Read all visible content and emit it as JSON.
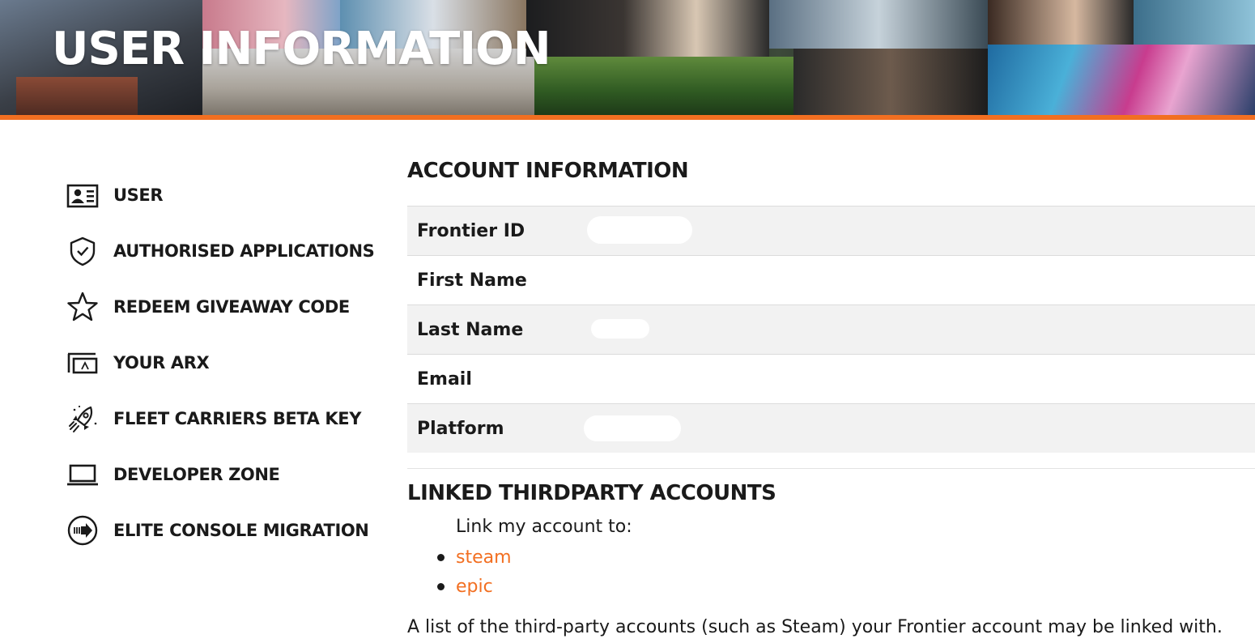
{
  "banner": {
    "title": "USER INFORMATION",
    "accent_color": "#f26f21"
  },
  "sidebar": {
    "items": [
      {
        "label": "USER",
        "icon": "user-card-icon"
      },
      {
        "label": "AUTHORISED APPLICATIONS",
        "icon": "shield-check-icon"
      },
      {
        "label": "REDEEM GIVEAWAY CODE",
        "icon": "star-icon"
      },
      {
        "label": "YOUR ARX",
        "icon": "arx-icon"
      },
      {
        "label": "FLEET CARRIERS BETA KEY",
        "icon": "rocket-icon"
      },
      {
        "label": "DEVELOPER ZONE",
        "icon": "laptop-icon"
      },
      {
        "label": "ELITE CONSOLE MIGRATION",
        "icon": "arrow-circle-icon"
      }
    ]
  },
  "account": {
    "heading": "ACCOUNT INFORMATION",
    "rows": [
      {
        "label": "Frontier ID",
        "value": ""
      },
      {
        "label": "First Name",
        "value": ""
      },
      {
        "label": "Last Name",
        "value": ""
      },
      {
        "label": "Email",
        "value": ""
      },
      {
        "label": "Platform",
        "value": ""
      }
    ]
  },
  "linked": {
    "heading": "LINKED THIRDPARTY ACCOUNTS",
    "intro": "Link my account to:",
    "links": [
      "steam",
      "epic"
    ],
    "description": "A list of the third-party accounts (such as Steam) your Frontier account may be linked with.",
    "link_color": "#f26f21"
  }
}
